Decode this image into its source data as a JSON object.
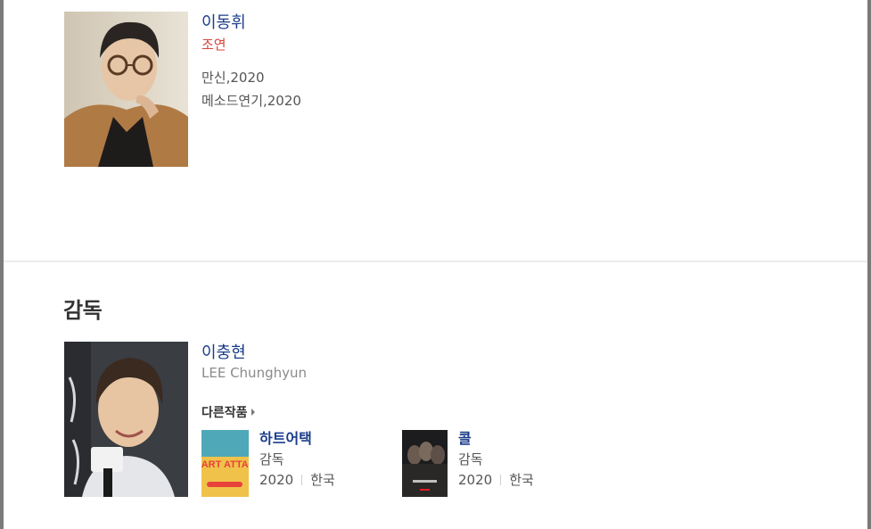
{
  "actor": {
    "name": "이동휘",
    "role": "조연",
    "works": [
      "만신,2020",
      "메소드연기,2020"
    ]
  },
  "director_section": {
    "title": "감독",
    "person": {
      "name": "이충현",
      "english_name": "LEE Chunghyun",
      "more_works_label": "다른작품"
    },
    "films": [
      {
        "title": "하트어택",
        "role": "감독",
        "year": "2020",
        "country": "한국",
        "poster_text": "HEART ATTACK"
      },
      {
        "title": "콜",
        "role": "감독",
        "year": "2020",
        "country": "한국"
      }
    ]
  },
  "colors": {
    "link": "#1a3c8a",
    "role_red": "#d9453b",
    "frame": "#7a7a7a",
    "divider": "#ececec"
  }
}
